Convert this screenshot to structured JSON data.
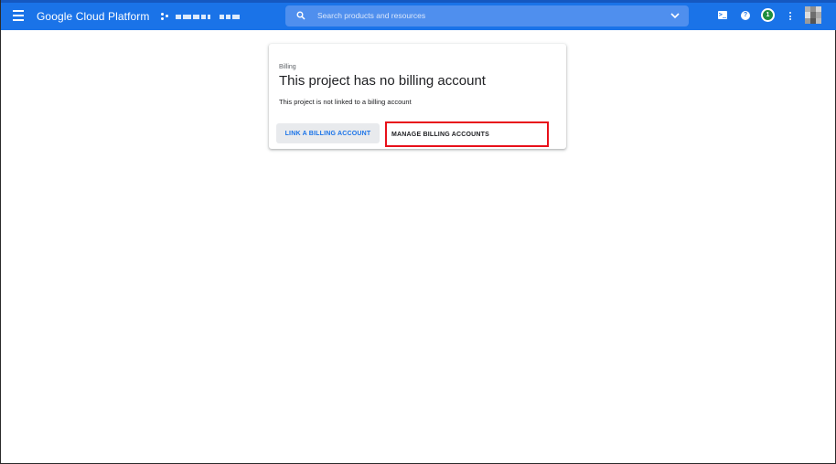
{
  "header": {
    "title": "Google Cloud Platform",
    "search_placeholder": "Search products and resources",
    "notification_count": "1",
    "icons": [
      "menu-icon",
      "project-icon",
      "search-icon",
      "chevron-down-icon",
      "terminal-icon",
      "help-icon",
      "more-vert-icon"
    ]
  },
  "billing_card": {
    "overline": "Billing",
    "title": "This project has no billing account",
    "description": "This project is not linked to a billing account",
    "link_button": "LINK A BILLING ACCOUNT",
    "manage_button": "MANAGE BILLING ACCOUNTS"
  },
  "colors": {
    "brand_blue": "#1a73e8",
    "highlight_red": "#e8101a",
    "badge_green": "#1e8e3e"
  }
}
